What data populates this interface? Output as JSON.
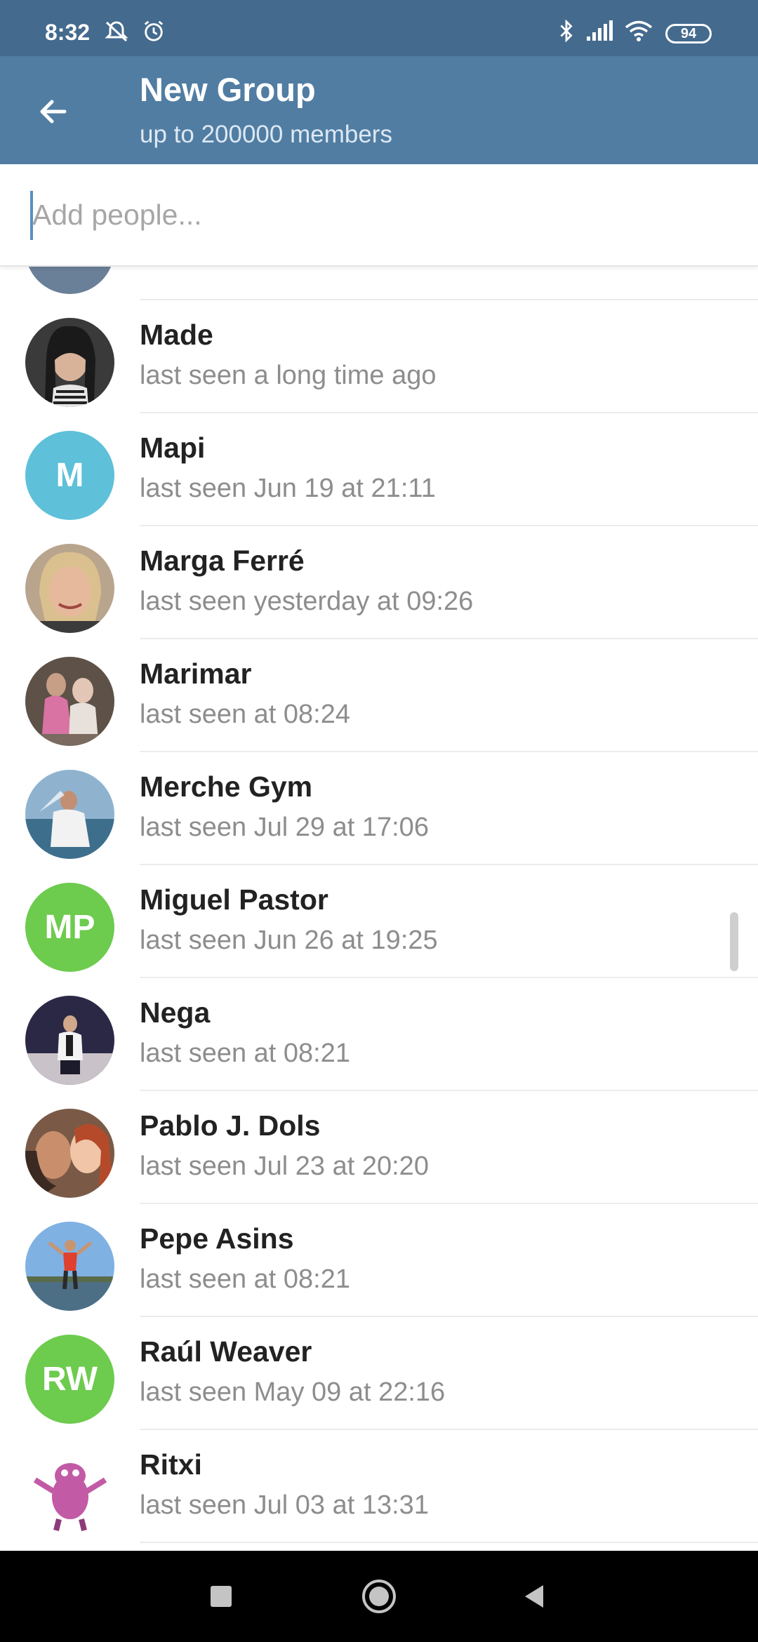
{
  "status_bar": {
    "time": "8:32",
    "battery": "94"
  },
  "header": {
    "title": "New Group",
    "subtitle": "up to 200000 members"
  },
  "search": {
    "placeholder": "Add people..."
  },
  "contacts": [
    {
      "name": "Made",
      "status": "last seen a long time ago",
      "avatar": "photo"
    },
    {
      "name": "Mapi",
      "status": "last seen Jun 19 at 21:11",
      "avatar_initials": "M",
      "avatar_color": "#5ec0d9"
    },
    {
      "name": "Marga Ferré",
      "status": "last seen yesterday at 09:26",
      "avatar": "photo"
    },
    {
      "name": "Marimar",
      "status": "last seen at 08:24",
      "avatar": "photo"
    },
    {
      "name": "Merche Gym",
      "status": "last seen Jul 29 at 17:06",
      "avatar": "photo"
    },
    {
      "name": "Miguel Pastor",
      "status": "last seen Jun 26 at 19:25",
      "avatar_initials": "MP",
      "avatar_color": "#6dcb4e"
    },
    {
      "name": "Nega",
      "status": "last seen at 08:21",
      "avatar": "photo"
    },
    {
      "name": "Pablo J. Dols",
      "status": "last seen Jul 23 at 20:20",
      "avatar": "photo"
    },
    {
      "name": "Pepe Asins",
      "status": "last seen at 08:21",
      "avatar": "photo"
    },
    {
      "name": "Raúl Weaver",
      "status": "last seen May 09 at 22:16",
      "avatar_initials": "RW",
      "avatar_color": "#6dcb4e"
    },
    {
      "name": "Ritxi",
      "status": "last seen Jul 03 at 13:31",
      "avatar": "photo"
    }
  ],
  "colors": {
    "status_bar": "#446a8e",
    "header": "#517da2",
    "accent": "#5a8fbf"
  }
}
